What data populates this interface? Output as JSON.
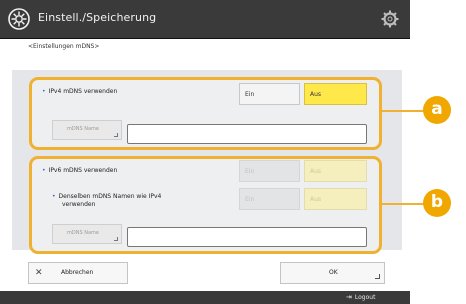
{
  "header": {
    "title": "Einstell./Speicherung",
    "title_icon": "settings-wrench-icon",
    "settings_icon": "gear-icon"
  },
  "breadcrumb": "<Einstellungen mDNS>",
  "ipv4": {
    "label": "IPv4 mDNS verwenden",
    "on_label": "Ein",
    "off_label": "Aus",
    "selected": "Aus",
    "name_button": "mDNS Name",
    "name_value": ""
  },
  "ipv6": {
    "label": "IPv6 mDNS verwenden",
    "on_label": "Ein",
    "off_label": "Aus",
    "selected": "Aus",
    "same_name_label_line1": "Denselben mDNS Namen wie IPv4",
    "same_name_label_line2": "verwenden",
    "same_on_label": "Ein",
    "same_off_label": "Aus",
    "name_button": "mDNS Name",
    "name_value": ""
  },
  "callouts": {
    "a": "a",
    "b": "b"
  },
  "actions": {
    "cancel_label": "Abbrechen",
    "ok_label": "OK"
  },
  "footer": {
    "logout_label": "Logout"
  },
  "colors": {
    "accent_outline": "#f0b030",
    "selected_yellow": "#ffe84a",
    "callout": "#f0a800",
    "bar": "#3a3a3a"
  }
}
